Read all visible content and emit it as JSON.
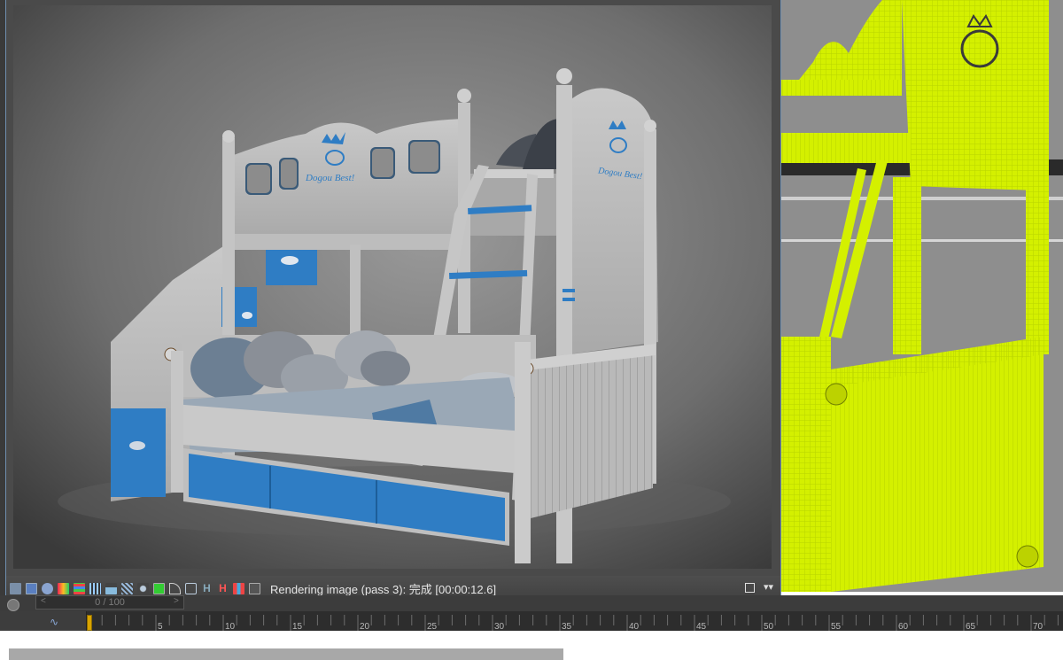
{
  "status_bar": {
    "status_text": "Rendering image (pass 3): 完成 [00:00:12.6]",
    "icons": [
      "display-icon",
      "render-channel-icon",
      "info-icon",
      "color-swatch-icon",
      "rgb-icon",
      "grid-icon",
      "histogram-icon",
      "hatch-icon",
      "sparkle-icon",
      "green-square-icon",
      "curve-icon",
      "lens-icon",
      "h-icon",
      "bracket-icon",
      "bars-icon",
      "frame-icon"
    ],
    "restore_icon": "restore-icon",
    "chevron_icon": "chevron-down-icon"
  },
  "frame_counter": "0 / 100",
  "timeline": {
    "tick_labels": [
      "0",
      "5",
      "10",
      "15",
      "20",
      "25",
      "30",
      "35",
      "40",
      "45",
      "50",
      "55",
      "60",
      "65",
      "70"
    ],
    "accent_color": "#d9a400"
  },
  "render": {
    "headboard_text": "Dogou Best!",
    "side_text": "Dogou Best!"
  },
  "colors": {
    "wire_yellow": "#d4f000",
    "accent_blue": "#2f7dc4"
  }
}
